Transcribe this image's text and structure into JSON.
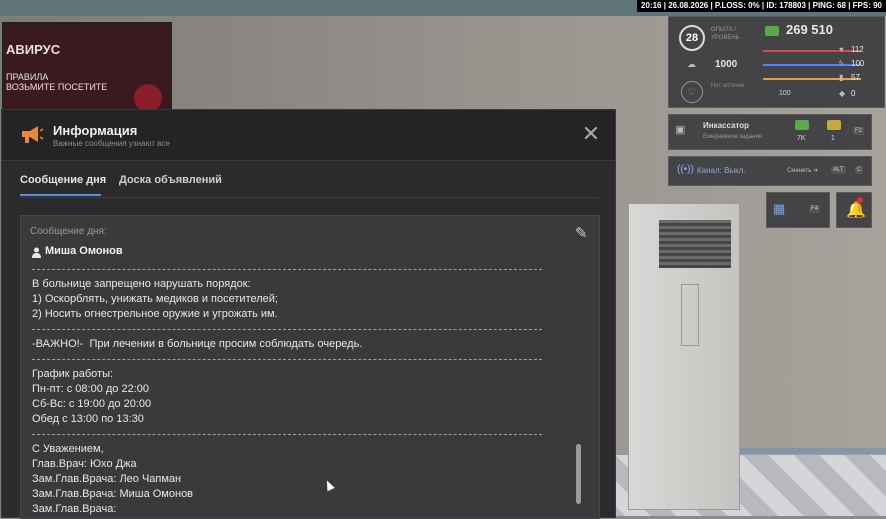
{
  "status_bar": "20:16 | 26.08.2026 | P.LOSS: 0% | ID: 178803 | PING: 68 | FPS: 90",
  "poster": {
    "title": "АВИРУС",
    "line1": "ПРАВИЛА",
    "line2": "ВОЗЬМИТЕ",
    "line3": "ПОСЕТИТЕ"
  },
  "hud": {
    "level": "28",
    "level_label": "ОПЫТА / УРОВЕНЬ",
    "money": "269 510",
    "rating": "1000",
    "health_label": "Нет аптечки",
    "stats": [
      {
        "icon": "heart-icon",
        "value": "112",
        "color": "#e2e2e2"
      },
      {
        "icon": "lightning-icon",
        "value": "100",
        "color": "#e2e2e2"
      },
      {
        "icon": "hunger-icon",
        "value": "57",
        "color": "#e2e2e2"
      },
      {
        "icon": "shield-icon",
        "value": "0",
        "color": "#e2e2e2"
      }
    ],
    "bars": [
      "#d84a4a",
      "#4f83ff",
      "#e0a23a",
      "#7a7a7a"
    ],
    "small_stat": "100",
    "job": {
      "title": "Инкассатор",
      "subtitle": "Ежедневное задание",
      "reward1": "7K",
      "reward2": "1",
      "key": "F2"
    },
    "channel": {
      "label": "Канал: Выкл.",
      "switch": "Сменить",
      "keys": [
        "ALT",
        "C"
      ]
    },
    "calendar_key": "F4"
  },
  "panel": {
    "title": "Информация",
    "subtitle": "Важные сообщения узнают все",
    "tabs": [
      {
        "label": "Сообщение дня"
      },
      {
        "label": "Доска объявлений"
      }
    ],
    "content_label": "Сообщение дня:",
    "author": "Миша Омонов",
    "lines": [
      "",
      "----------------------------------------------------------------------------------------------------------------------------------------",
      "В больнице запрещено нарушать порядок:",
      "1) Оскорблять, унижать медиков и посетителей;",
      "2) Носить огнестрельное оружие и угрожать им.",
      "----------------------------------------------------------------------------------------------------------------------------------------",
      "-ВАЖНО!-  При лечении в больнице просим соблюдать очередь.",
      "----------------------------------------------------------------------------------------------------------------------------------------",
      "График работы:",
      "Пн-пт: с 08:00 до 22:00",
      "Сб-Вс: с 19:00 до 20:00",
      "Обед с 13:00 по 13:30",
      "----------------------------------------------------------------------------------------------------------------------------------------",
      "С Уважением,",
      "Глав.Врач: Юхо Джа",
      "Зам.Глав.Врача: Лео Чапман",
      "Зам.Глав.Врача: Миша Омонов",
      "Зам.Глав.Врача:"
    ]
  }
}
